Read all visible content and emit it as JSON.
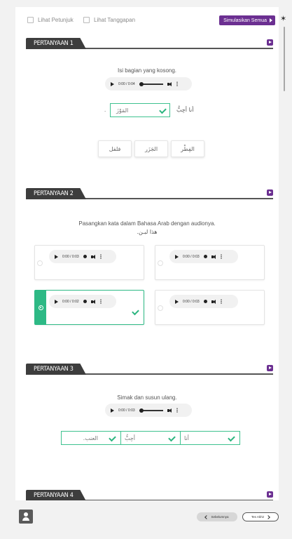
{
  "toolbar": {
    "show_hints_label": "Lihat Petunjuk",
    "show_responses_label": "Lihat Tanggapan",
    "simulate_all_label": "Simulasikan Semua"
  },
  "q1": {
    "header": "PERTANYAAN 1",
    "instruction": "Isi bagian yang kosong.",
    "audio_time": "0:00 / 0:04",
    "sentence_prefix": "أنا أحِبُّ",
    "sentence_suffix": ".",
    "answer": "المَوْزَ",
    "options": [
      "الفِطْر",
      "الجَزَر",
      "فلفل"
    ]
  },
  "q2": {
    "header": "PERTANYAAN 2",
    "instruction": "Pasangkan kata dalam Bahasa Arab dengan audionya.",
    "arabic_prompt": "هذا لبـن.",
    "audio_times": [
      "0:00 / 0:03",
      "0:00 / 0:03",
      "0:00 / 0:02",
      "0:00 / 0:03"
    ]
  },
  "q3": {
    "header": "PERTANYAAN 3",
    "instruction": "Simak dan susun ulang.",
    "audio_time": "0:00 / 0:03",
    "slots": [
      "العنب.",
      "أحِبُّ",
      "أنا"
    ]
  },
  "q4": {
    "header": "PERTANYAAN 4"
  },
  "bottom": {
    "prev_label": "Sebelumnya",
    "next_label": "Tes Akhir"
  },
  "colors": {
    "accent": "#6b2f91",
    "correct": "#2db985",
    "header_tab": "#3d3d3d"
  }
}
